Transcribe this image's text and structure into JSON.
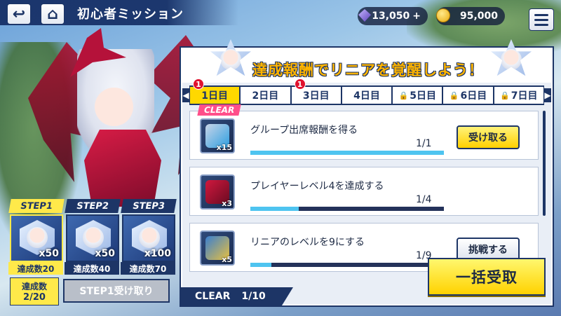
{
  "header": {
    "title": "初心者ミッション"
  },
  "currency": {
    "gems": "13,050",
    "gems_plus": "+",
    "coins": "95,000"
  },
  "banner": {
    "text": "達成報酬でリニアを覚醒しよう！"
  },
  "tabs": [
    {
      "label": "1日目",
      "locked": false,
      "active": true,
      "badge": "1"
    },
    {
      "label": "2日目",
      "locked": false,
      "active": false,
      "badge": ""
    },
    {
      "label": "3日目",
      "locked": false,
      "active": false,
      "badge": "1"
    },
    {
      "label": "4日目",
      "locked": false,
      "active": false,
      "badge": ""
    },
    {
      "label": "5日目",
      "locked": true,
      "active": false,
      "badge": ""
    },
    {
      "label": "6日目",
      "locked": true,
      "active": false,
      "badge": ""
    },
    {
      "label": "7日目",
      "locked": true,
      "active": false,
      "badge": ""
    }
  ],
  "missions": [
    {
      "label": "グループ出席報酬を得る",
      "progress": "1/1",
      "fraction": 1.0,
      "qty": "x15",
      "button": "受け取る",
      "button_style": "yellow",
      "clear": "CLEAR"
    },
    {
      "label": "プレイヤーレベル4を達成する",
      "progress": "1/4",
      "fraction": 0.25,
      "qty": "x3",
      "button": "",
      "button_style": "",
      "clear": ""
    },
    {
      "label": "リニアのレベルを9にする",
      "progress": "1/9",
      "fraction": 0.11,
      "qty": "x5",
      "button": "挑戦する",
      "button_style": "white",
      "clear": ""
    }
  ],
  "footer": {
    "clear_label": "CLEAR",
    "clear_count": "1/10"
  },
  "bulk_button": "一括受取",
  "steps": [
    {
      "label": "STEP1",
      "qty": "x50",
      "requirement": "達成数20",
      "active": true
    },
    {
      "label": "STEP2",
      "qty": "x50",
      "requirement": "達成数40",
      "active": false
    },
    {
      "label": "STEP3",
      "qty": "x100",
      "requirement": "達成数70",
      "active": false
    }
  ],
  "step_progress": {
    "label": "達成数",
    "value": "2/20"
  },
  "step_claim_button": "STEP1受け取り"
}
